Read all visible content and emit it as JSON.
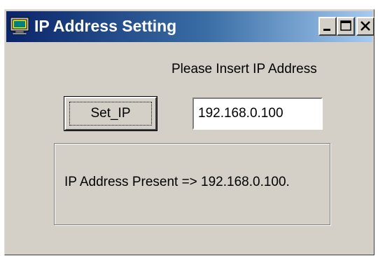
{
  "window": {
    "title": "IP Address Setting",
    "icon": "computer-monitor-icon",
    "controls": {
      "minimize_icon": "minimize-icon",
      "maximize_icon": "maximize-icon",
      "close_icon": "close-icon"
    }
  },
  "form": {
    "prompt_label": "Please Insert IP Address",
    "set_button_label": "Set_IP",
    "ip_input_value": "192.168.0.100"
  },
  "status": {
    "text": "IP Address Present =>   192.168.0.100."
  },
  "colors": {
    "titlebar_start": "#0a246a",
    "titlebar_end": "#a6caf0",
    "face": "#d4d0c8"
  }
}
